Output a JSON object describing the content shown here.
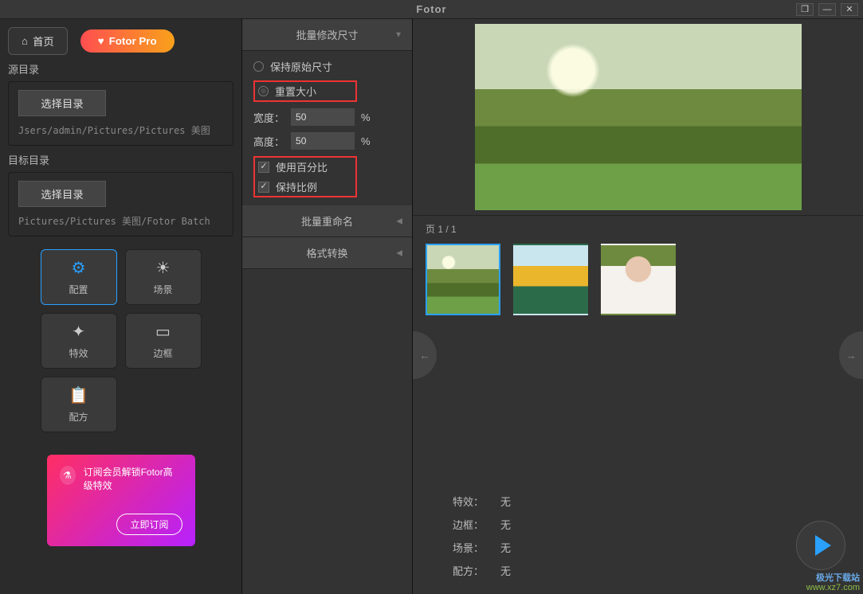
{
  "titlebar": {
    "title": "Fotor"
  },
  "left": {
    "home": "首页",
    "pro": "Fotor Pro",
    "source_label": "源目录",
    "target_label": "目标目录",
    "choose": "选择目录",
    "source_path": "Jsers/admin/Pictures/Pictures 美图",
    "target_path": "Pictures/Pictures 美图/Fotor Batch",
    "tools": {
      "config": "配置",
      "scene": "场景",
      "effect": "特效",
      "frame": "边框",
      "recipe": "配方"
    },
    "promo": {
      "text": "订阅会员解锁Fotor高级特效",
      "cta": "立即订阅"
    }
  },
  "mid": {
    "resize_header": "批量修改尺寸",
    "rename_header": "批量重命名",
    "format_header": "格式转换",
    "keep_original": "保持原始尺寸",
    "reset_size": "重置大小",
    "width_label": "宽度：",
    "height_label": "高度：",
    "width_value": "50",
    "height_value": "50",
    "unit": "%",
    "use_percent": "使用百分比",
    "keep_ratio": "保持比例"
  },
  "right": {
    "page_label": "页 1 / 1",
    "summary": {
      "effect_k": "特效：",
      "effect_v": "无",
      "frame_k": "边框：",
      "frame_v": "无",
      "scene_k": "场景：",
      "scene_v": "无",
      "recipe_k": "配方：",
      "recipe_v": "无"
    }
  },
  "watermark": {
    "l1": "极光下载站",
    "l2": "www.xz7.com"
  }
}
